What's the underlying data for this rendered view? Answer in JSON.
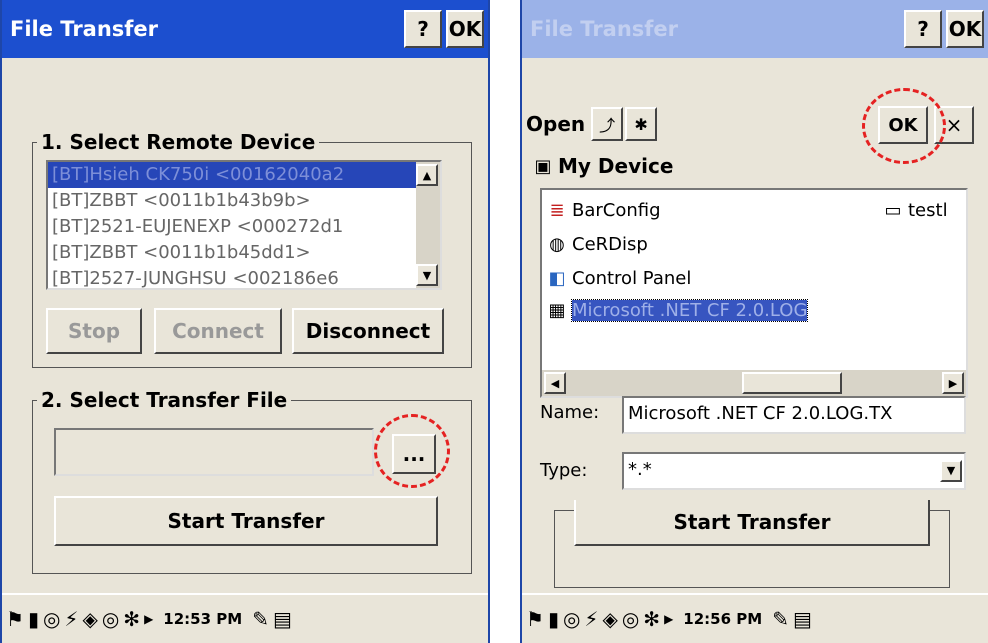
{
  "left": {
    "title": "File Transfer",
    "help_label": "?",
    "ok_label": "OK",
    "section1_label": "1. Select Remote Device",
    "devices": [
      "[BT]Hsieh CK750i <00162040a2",
      "[BT]ZBBT <0011b1b43b9b>",
      "[BT]2521-EUJENEXP <000272d1",
      "[BT]ZBBT <0011b1b45dd1>",
      "[BT]2527-JUNGHSU <002186e6"
    ],
    "stop_label": "Stop",
    "connect_label": "Connect",
    "disconnect_label": "Disconnect",
    "section2_label": "2. Select Transfer File",
    "file_value": "",
    "browse_label": "...",
    "start_label": "Start Transfer",
    "clock": "12:53 PM"
  },
  "right": {
    "title": "File Transfer",
    "help_label": "?",
    "ok_label": "OK",
    "open_label": "Open",
    "dialog_ok_label": "OK",
    "close_label": "×",
    "location": "My Device",
    "files": [
      {
        "name": "BarConfig",
        "icon": "barconfig-icon"
      },
      {
        "name": "CeRDisp",
        "icon": "cerdisp-icon"
      },
      {
        "name": "Control Panel",
        "icon": "control-panel-icon"
      },
      {
        "name": "Microsoft .NET CF 2.0.LOG",
        "icon": "log-file-icon"
      },
      {
        "name": "testl",
        "icon": "window-icon"
      }
    ],
    "name_label": "Name:",
    "name_value": "Microsoft .NET CF 2.0.LOG.TX",
    "type_label": "Type:",
    "type_value": "*.*",
    "behind_button": "Start Transfer",
    "clock": "12:56 PM"
  },
  "colors": {
    "titlebar_active": "#1c4fcf",
    "titlebar_inactive": "#9bb2e8",
    "highlight": "#e52222",
    "selection": "#2646b8"
  }
}
